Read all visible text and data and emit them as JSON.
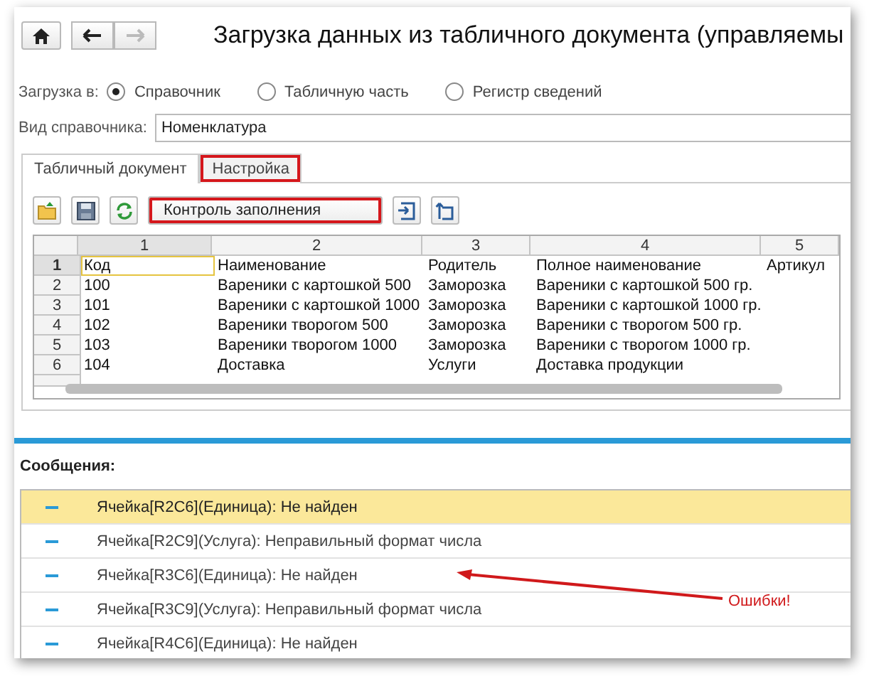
{
  "window": {
    "title": "Загрузка данных из табличного документа (управляемы"
  },
  "load_to": {
    "label": "Загрузка в:",
    "options": [
      {
        "label": "Справочник",
        "selected": true
      },
      {
        "label": "Табличную часть",
        "selected": false
      },
      {
        "label": "Регистр сведений",
        "selected": false
      }
    ]
  },
  "catalog_field": {
    "label": "Вид справочника:",
    "value": "Номенклатура"
  },
  "tabs": [
    {
      "label": "Табличный документ",
      "selected": true,
      "highlighted": false
    },
    {
      "label": "Настройка",
      "selected": false,
      "highlighted": true
    }
  ],
  "toolbar": [
    {
      "kind": "open"
    },
    {
      "kind": "save"
    },
    {
      "kind": "refresh"
    },
    {
      "kind": "text",
      "label": "Контроль заполнения",
      "highlighted": true
    },
    {
      "kind": "import"
    },
    {
      "kind": "export"
    }
  ],
  "sheet": {
    "columns": [
      "1",
      "2",
      "3",
      "4",
      "5"
    ],
    "rows": [
      {
        "number": "1",
        "selected": true,
        "cells": [
          "Код",
          "Наименование",
          "Родитель",
          "Полное наименование",
          "Артикул"
        ]
      },
      {
        "number": "2",
        "selected": false,
        "cells": [
          "100",
          "Вареники с картошкой 500",
          "Заморозка",
          "Вареники с картошкой  500 гр.",
          ""
        ]
      },
      {
        "number": "3",
        "selected": false,
        "cells": [
          "101",
          "Вареники с картошкой 1000",
          "Заморозка",
          "Вареники с картошкой 1000 гр.",
          ""
        ]
      },
      {
        "number": "4",
        "selected": false,
        "cells": [
          "102",
          "Вареники творогом 500",
          "Заморозка",
          "Вареники с творогом 500 гр.",
          ""
        ]
      },
      {
        "number": "5",
        "selected": false,
        "cells": [
          "103",
          "Вареники творогом 1000",
          "Заморозка",
          "Вареники с творогом 1000 гр.",
          ""
        ]
      },
      {
        "number": "6",
        "selected": false,
        "cells": [
          "104",
          "Доставка",
          "Услуги",
          "Доставка продукции",
          ""
        ]
      }
    ]
  },
  "messages": {
    "title": "Сообщения:",
    "items": [
      {
        "text": "Ячейка[R2C6](Единица): Не найден",
        "selected": true
      },
      {
        "text": "Ячейка[R2C9](Услуга): Неправильный формат числа",
        "selected": false
      },
      {
        "text": "Ячейка[R3C6](Единица): Не найден",
        "selected": false
      },
      {
        "text": "Ячейка[R3C9](Услуга): Неправильный формат числа",
        "selected": false
      },
      {
        "text": "Ячейка[R4C6](Единица): Не найден",
        "selected": false
      }
    ]
  },
  "annotation": {
    "text": "Ошибки!"
  }
}
